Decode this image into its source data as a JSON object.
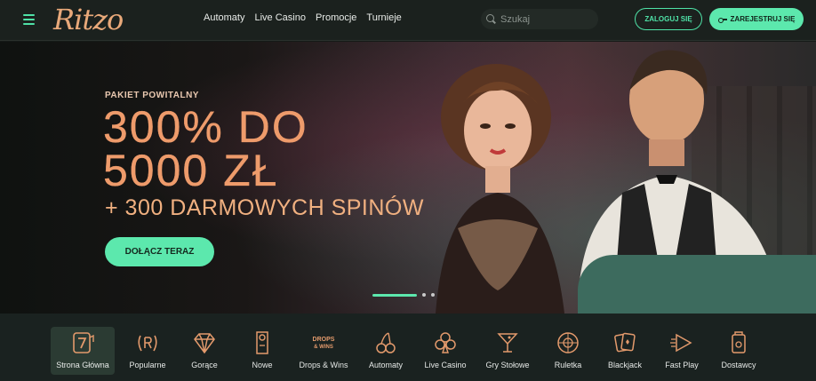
{
  "header": {
    "logo": "Ritzo",
    "nav": [
      "Automaty",
      "Live Casino",
      "Promocje",
      "Turnieje"
    ],
    "search_placeholder": "Szukaj",
    "login_label": "ZALOGUJ SIĘ",
    "register_label": "ZAREJESTRUJ SIĘ"
  },
  "hero": {
    "subtitle": "PAKIET POWITALNY",
    "title_line1": "300% DO",
    "title_line2": "5000 ZŁ",
    "bonus": "+ 300 DARMOWYCH SPINÓW",
    "cta": "DOŁĄCZ TERAZ"
  },
  "categories": [
    {
      "label": "Strona Główna",
      "icon": "slot-seven-icon"
    },
    {
      "label": "Popularne",
      "icon": "laurel-r-icon"
    },
    {
      "label": "Gorące",
      "icon": "diamond-icon"
    },
    {
      "label": "Nowe",
      "icon": "door-hanger-icon"
    },
    {
      "label": "Drops & Wins",
      "icon": "drops-wins-icon",
      "badge": "DROPS & WINS"
    },
    {
      "label": "Automaty",
      "icon": "cherries-icon"
    },
    {
      "label": "Live Casino",
      "icon": "club-icon"
    },
    {
      "label": "Gry Stołowe",
      "icon": "cocktail-icon"
    },
    {
      "label": "Ruletka",
      "icon": "roulette-icon"
    },
    {
      "label": "Blackjack",
      "icon": "cards-icon"
    },
    {
      "label": "Fast Play",
      "icon": "fast-play-icon"
    },
    {
      "label": "Dostawcy",
      "icon": "provider-icon"
    }
  ],
  "colors": {
    "accent": "#5ce8ad",
    "brand": "#ee9b6b",
    "icon": "#e39a6c"
  }
}
